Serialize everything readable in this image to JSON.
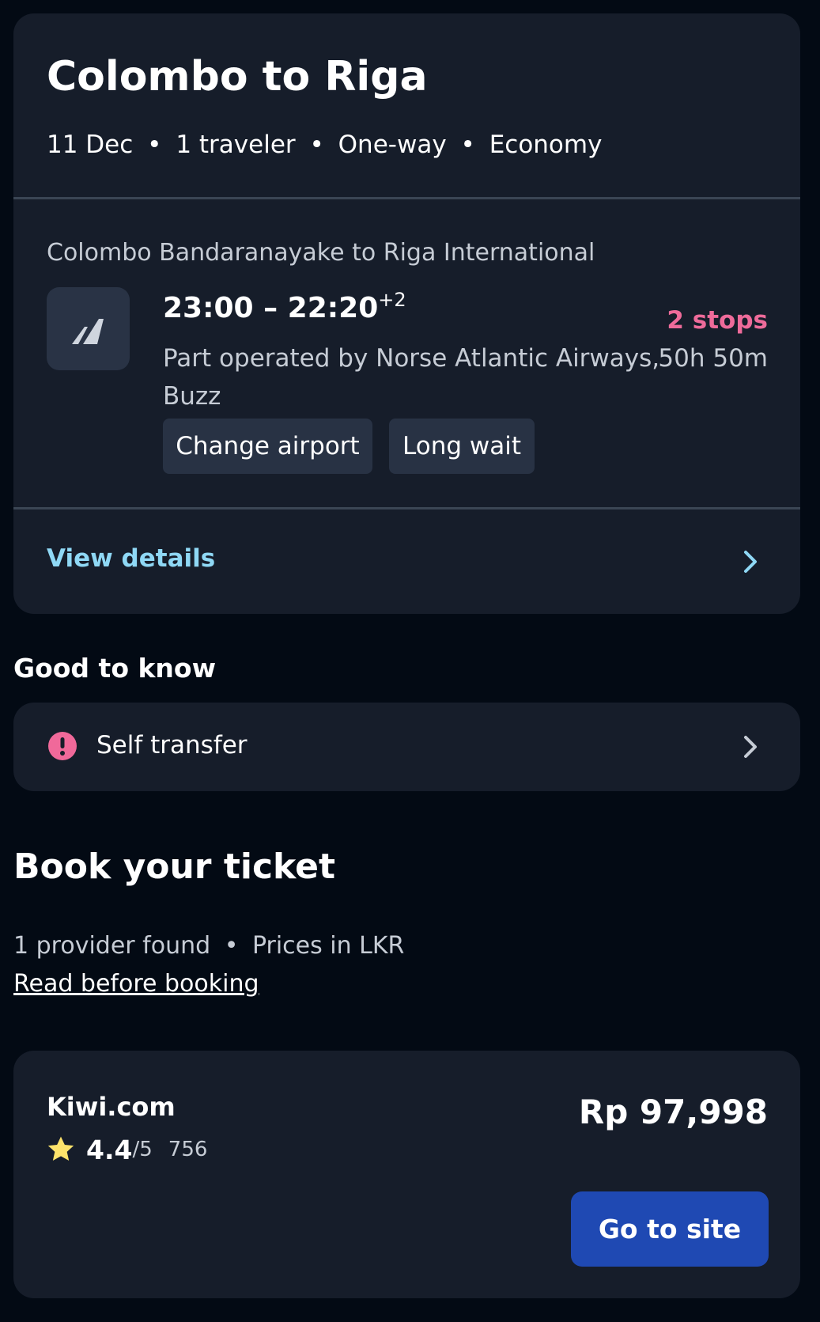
{
  "trip": {
    "title": "Colombo to Riga",
    "date": "11 Dec",
    "travelers": "1 traveler",
    "trip_type": "One-way",
    "cabin": "Economy",
    "separator": "•"
  },
  "flight": {
    "route": "Colombo Bandaranayake to Riga International",
    "airline_logo_icon": "airline-logo-icon",
    "times": "23:00 – 22:20",
    "day_offset": "+2",
    "operated_line1": "Part operated by Norse Atlantic Airways,",
    "operated_line2": "Buzz",
    "stops": "2 stops",
    "duration": "50h 50m",
    "tags": [
      "Change airport",
      "Long wait"
    ],
    "view_details": "View details",
    "chevron_icon": "chevron-right-icon"
  },
  "good_to_know": {
    "heading": "Good to know",
    "items": [
      {
        "label": "Self transfer",
        "icon": "alert-icon"
      }
    ]
  },
  "booking": {
    "heading": "Book your ticket",
    "providers_found": "1 provider found",
    "prices_in": "Prices in LKR",
    "read_before": "Read before booking"
  },
  "provider": {
    "name": "Kiwi.com",
    "rating": "4.4",
    "rating_scale": "/5",
    "reviews": "756",
    "price": "Rp 97,998",
    "cta": "Go to site",
    "star_icon": "star-icon"
  },
  "colors": {
    "background": "#030a14",
    "card": "#161d2a",
    "accent_link": "#8fd8f5",
    "stops_pink": "#ee6b9a",
    "alert_pink": "#f0699a",
    "star_yellow": "#fde36b",
    "button_blue": "#1f49b3"
  }
}
